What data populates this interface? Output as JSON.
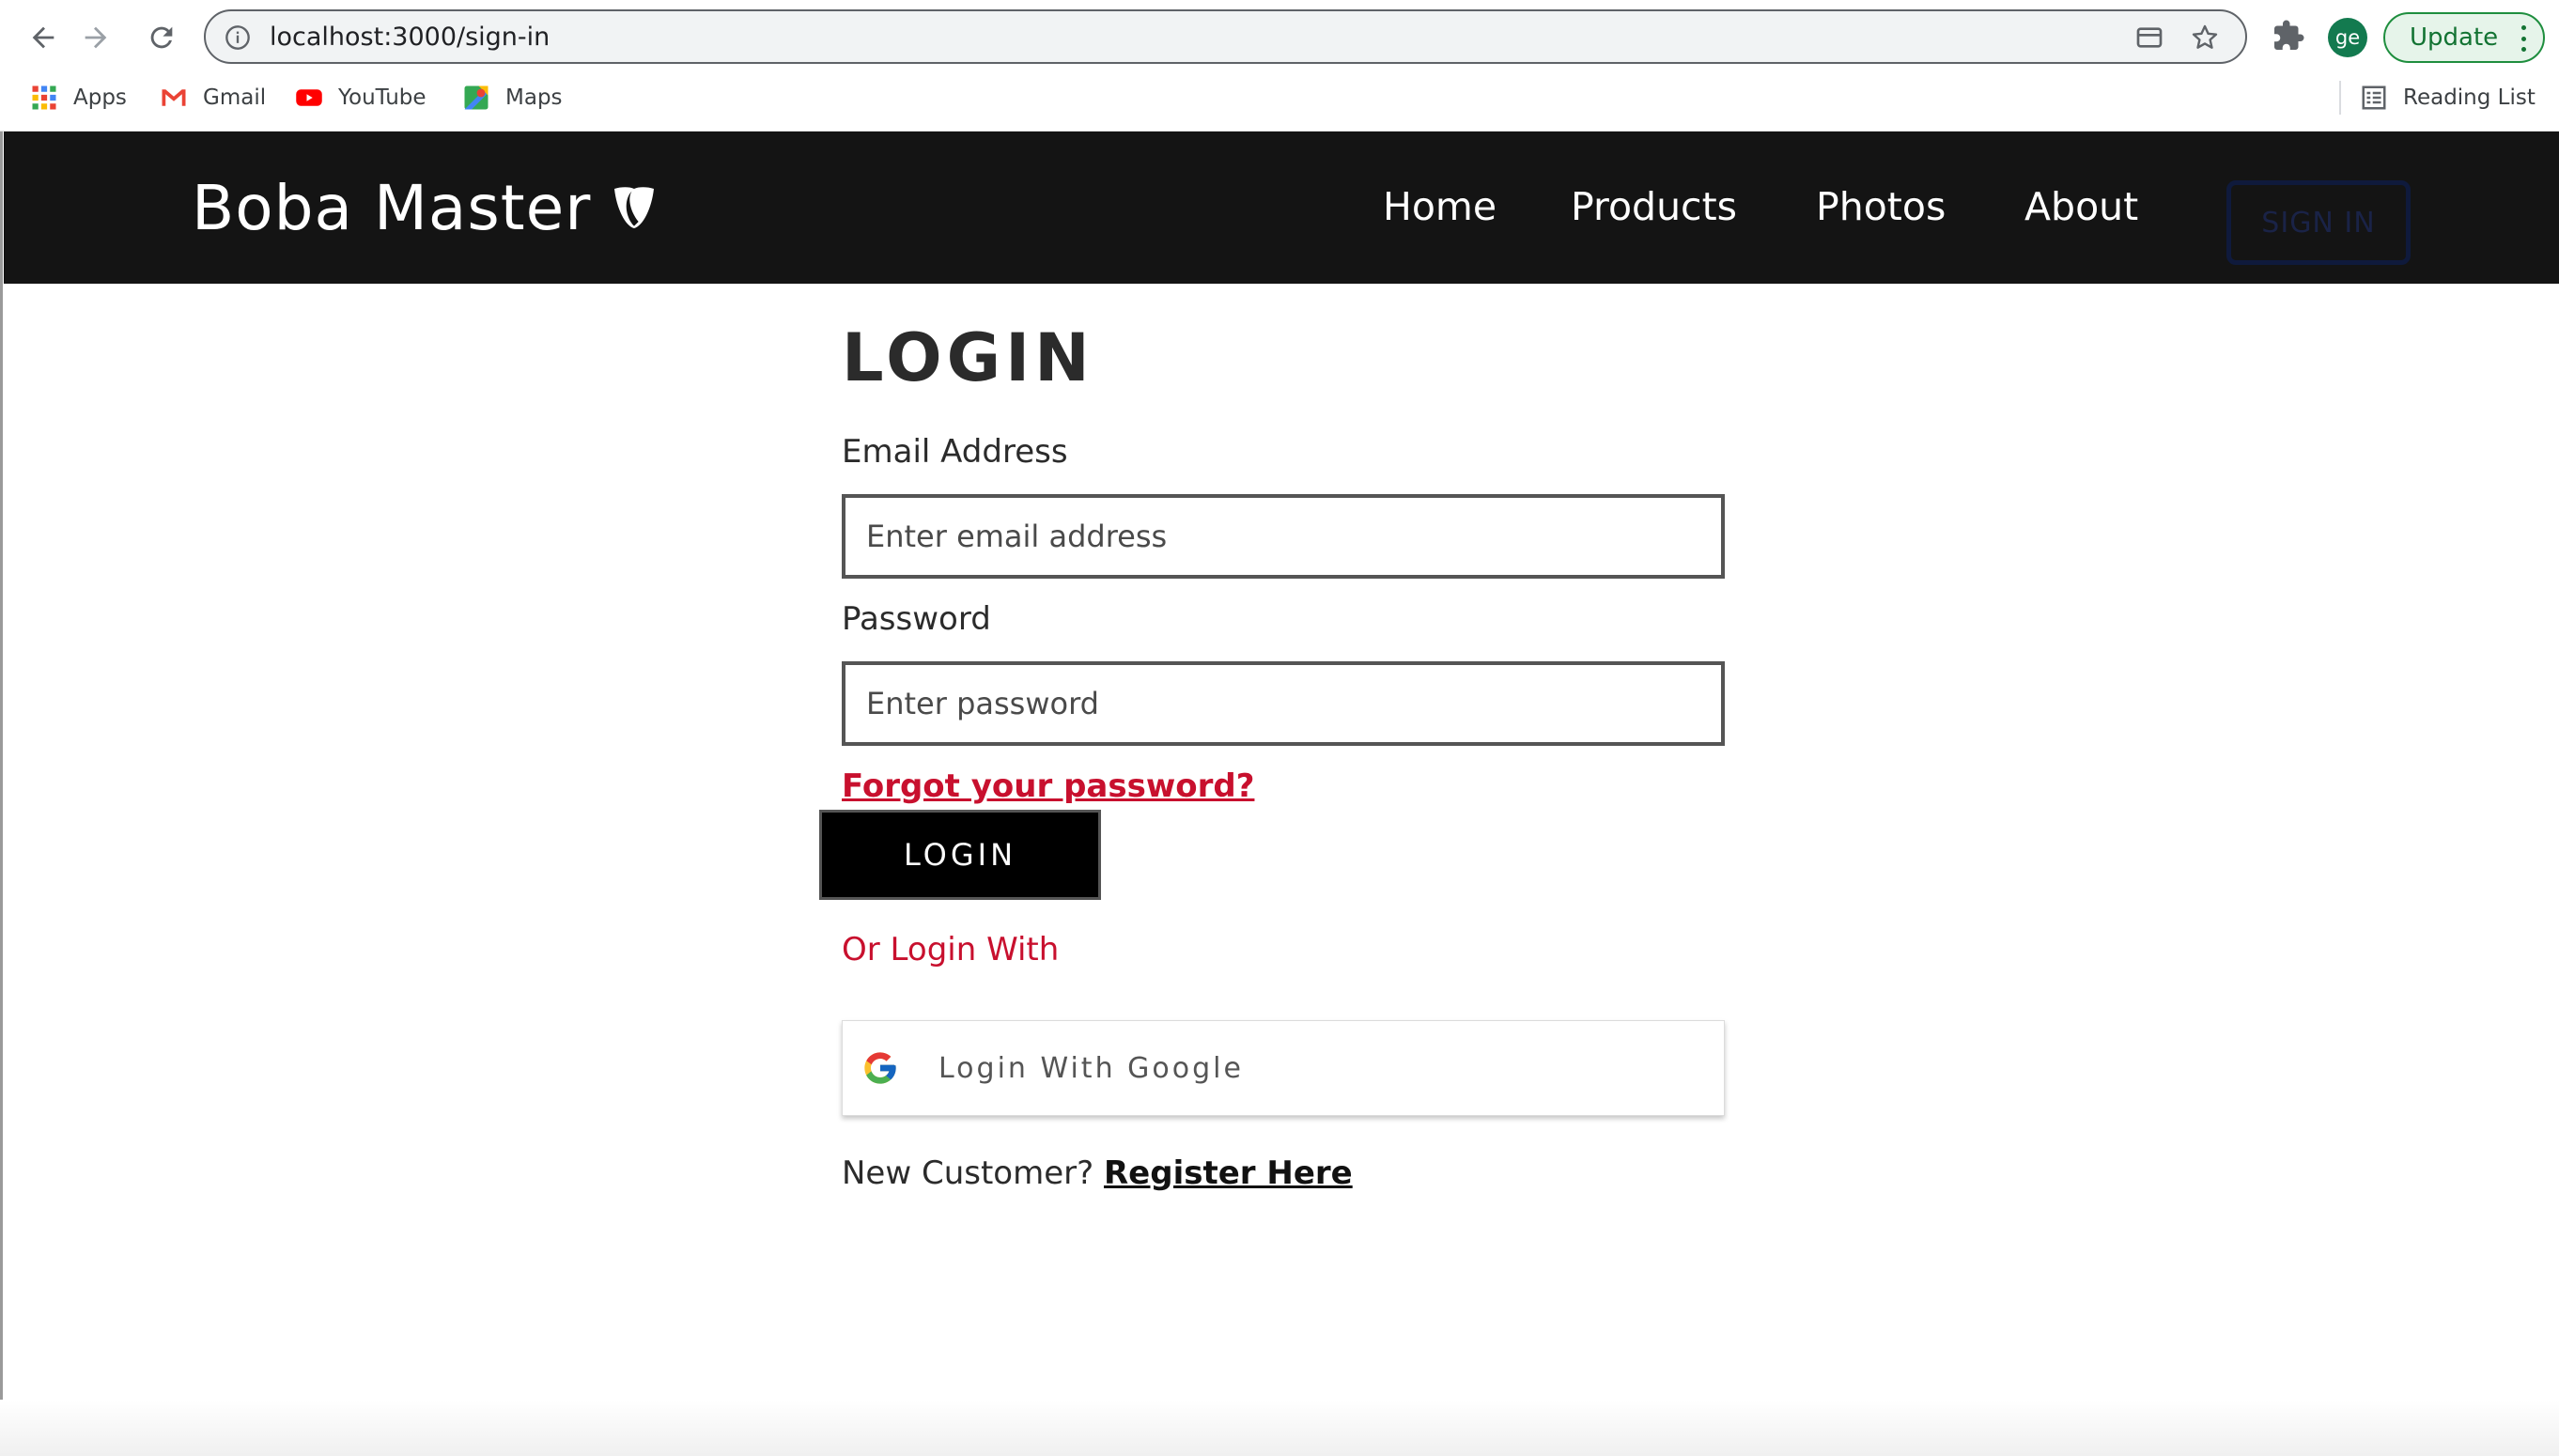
{
  "browser": {
    "url": "localhost:3000/sign-in",
    "profile_initials": "ge",
    "update_label": "Update",
    "icons": {
      "back": "arrow-left-icon",
      "forward": "arrow-right-icon",
      "reload": "reload-icon",
      "site_info": "info-icon",
      "tab_search": "card-icon",
      "bookmark": "star-icon",
      "extensions": "puzzle-icon",
      "menu": "kebab-menu-icon"
    },
    "bookmarks": [
      {
        "label": "Apps",
        "icon": "apps-grid-icon"
      },
      {
        "label": "Gmail",
        "icon": "gmail-icon"
      },
      {
        "label": "YouTube",
        "icon": "youtube-icon"
      },
      {
        "label": "Maps",
        "icon": "maps-icon"
      }
    ],
    "reading_list": "Reading List"
  },
  "site": {
    "brand": "Boba Master",
    "brand_icon": "typo3-shield-icon",
    "nav": [
      {
        "label": "Home"
      },
      {
        "label": "Products"
      },
      {
        "label": "Photos"
      },
      {
        "label": "About"
      }
    ],
    "signin_label": "SIGN IN"
  },
  "login": {
    "title": "LOGIN",
    "email_label": "Email Address",
    "email_placeholder": "Enter email address",
    "email_value": "",
    "password_label": "Password",
    "password_placeholder": "Enter password",
    "password_value": "",
    "forgot_label": "Forgot your password?",
    "submit_label": "LOGIN",
    "or_label": "Or Login With",
    "google_label": "Login With Google",
    "google_icon": "google-g-icon",
    "new_customer_label": "New Customer?",
    "register_label": "Register Here"
  },
  "colors": {
    "header_bg": "#141414",
    "accent_red": "#c8102e",
    "update_green": "#137333"
  }
}
